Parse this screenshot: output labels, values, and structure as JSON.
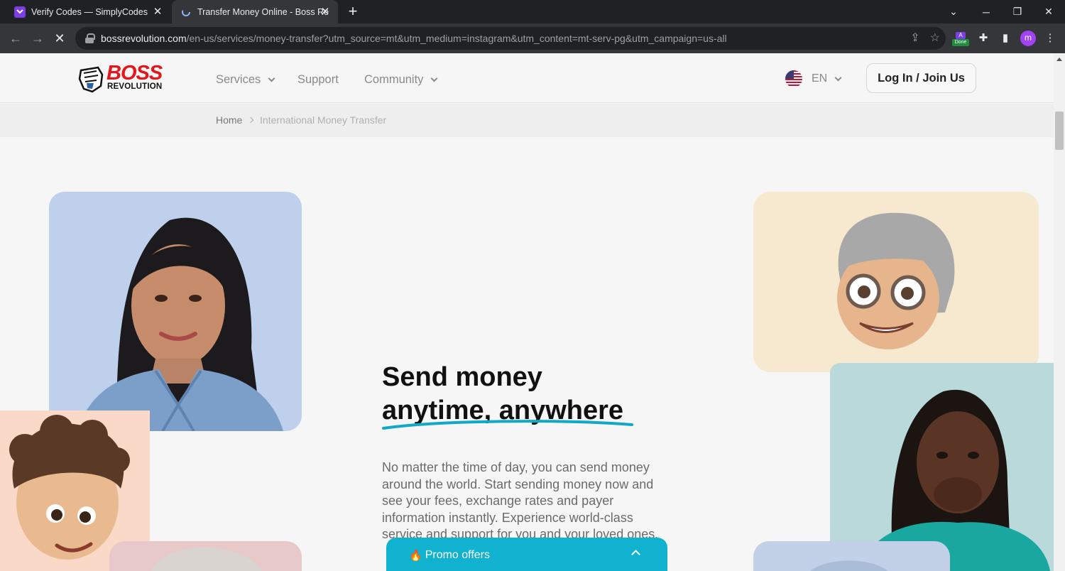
{
  "browser": {
    "tabs": [
      {
        "title": "Verify Codes — SimplyCodes",
        "active": false
      },
      {
        "title": "Transfer Money Online - Boss Re",
        "active": true
      }
    ],
    "url_host": "bossrevolution.com",
    "url_path": "/en-us/services/money-transfer?utm_source=mt&utm_medium=instagram&utm_content=mt-serv-pg&utm_campaign=us-all",
    "extension_badge_top": "A",
    "extension_badge_bottom": "Done",
    "profile_initial": "m"
  },
  "header": {
    "logo_top": "BOSS",
    "logo_bottom": "REVOLUTION",
    "nav": [
      {
        "label": "Services",
        "has_dropdown": true
      },
      {
        "label": "Support",
        "has_dropdown": false
      },
      {
        "label": "Community",
        "has_dropdown": true
      }
    ],
    "language": "EN",
    "login_label": "Log In / Join Us"
  },
  "breadcrumb": {
    "home": "Home",
    "current": "International Money Transfer"
  },
  "hero": {
    "title_line1": "Send money",
    "title_line2": "anytime, anywhere",
    "body": "No matter the time of day, you can send money around the world. Start sending money now and see your fees, exchange rates and payer information instantly. Experience world-class service and support for you and your loved ones."
  },
  "promo": {
    "label": "Promo offers"
  },
  "colors": {
    "brand_red": "#e3161b",
    "accent_teal": "#10b2cf",
    "card_blue": "#bfd0ec",
    "card_cream": "#f6e9cf",
    "card_teal": "#bad9db",
    "card_peach": "#fbd9c8",
    "card_pink": "#e8c9c9"
  }
}
